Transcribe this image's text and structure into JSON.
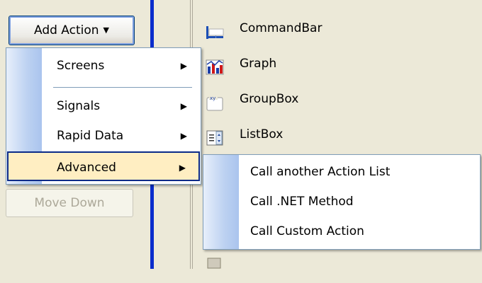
{
  "toolbar": {
    "add_action_label": "Add Action",
    "move_down_label": "Move Down"
  },
  "menu": {
    "items": [
      {
        "label": "Screens"
      },
      {
        "label": "Signals"
      },
      {
        "label": "Rapid Data"
      },
      {
        "label": "Advanced"
      }
    ]
  },
  "submenu": {
    "items": [
      {
        "label": "Call another Action List"
      },
      {
        "label": "Call .NET Method"
      },
      {
        "label": "Call Custom Action"
      }
    ]
  },
  "controls": [
    {
      "label": "CommandBar",
      "icon": "commandbar-icon"
    },
    {
      "label": "Graph",
      "icon": "graph-icon"
    },
    {
      "label": "GroupBox",
      "icon": "groupbox-icon"
    },
    {
      "label": "ListBox",
      "icon": "listbox-icon"
    }
  ],
  "colors": {
    "menu_highlight": "#ffeec2",
    "highlight_border": "#0b2a88",
    "splitter": "#0a2dcc"
  }
}
